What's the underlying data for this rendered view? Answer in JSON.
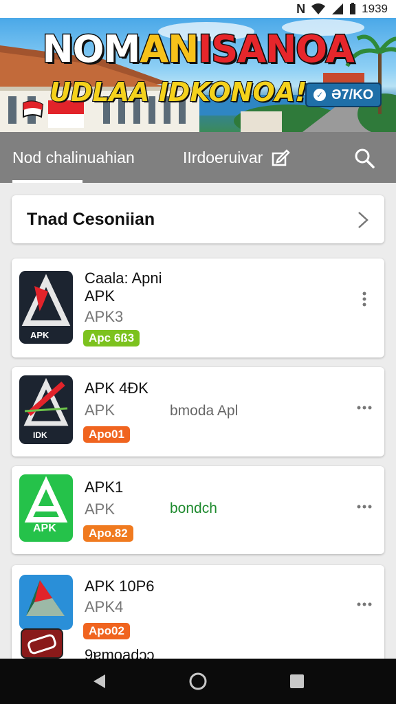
{
  "status_bar": {
    "time": "1939",
    "nfc_glyph": "N"
  },
  "banner": {
    "title_part1": "NOM",
    "title_part2": "AN",
    "title_part3": "ISANOA",
    "subtitle": "UDLAA IDKONOA!",
    "badge_text": "Ə7/KO",
    "badge_dot": "✓"
  },
  "tabs": [
    {
      "label": "Nod chalinuahian",
      "selected": true
    },
    {
      "label": "IIrdoeruivar",
      "icon": "edit-icon",
      "selected": false
    }
  ],
  "category": {
    "label": "Tnad Cesoniian"
  },
  "apps": [
    {
      "line1": "Caala: Apni",
      "line2": "APK",
      "line3": "APK3",
      "pill": "Apc 6ß3",
      "pill_color": "#7cc21e",
      "icon_caption": "APK"
    },
    {
      "line1": "APK 4ÐK",
      "line2": "APK",
      "side": "bmoda Apl",
      "side_color": "#666666",
      "pill": "Apo01",
      "pill_color": "#f0641f",
      "icon_caption": "IDK"
    },
    {
      "line1": "APK1",
      "line2": "APK",
      "side": "bondch",
      "side_color": "#1e8a2e",
      "pill": "Apo.82",
      "pill_color": "#f07a1f",
      "icon_caption": "APK"
    },
    {
      "line1": "APK 10P6",
      "line2": "APK4",
      "line3": "9ɐmoadɔɔ",
      "pill": "Apo02",
      "pill_color": "#f0641f"
    }
  ],
  "colors": {
    "accent": "#808080",
    "tab_text": "#ffffff",
    "nav_bar": "#0b0b0b",
    "card_background": "#ffffff"
  },
  "icons": [
    "wifi-icon",
    "signal-icon",
    "battery-icon",
    "edit-icon",
    "search-icon",
    "chevron-right-icon",
    "more-vertical-icon",
    "more-horizontal-icon",
    "back-icon",
    "home-icon",
    "recents-icon"
  ]
}
